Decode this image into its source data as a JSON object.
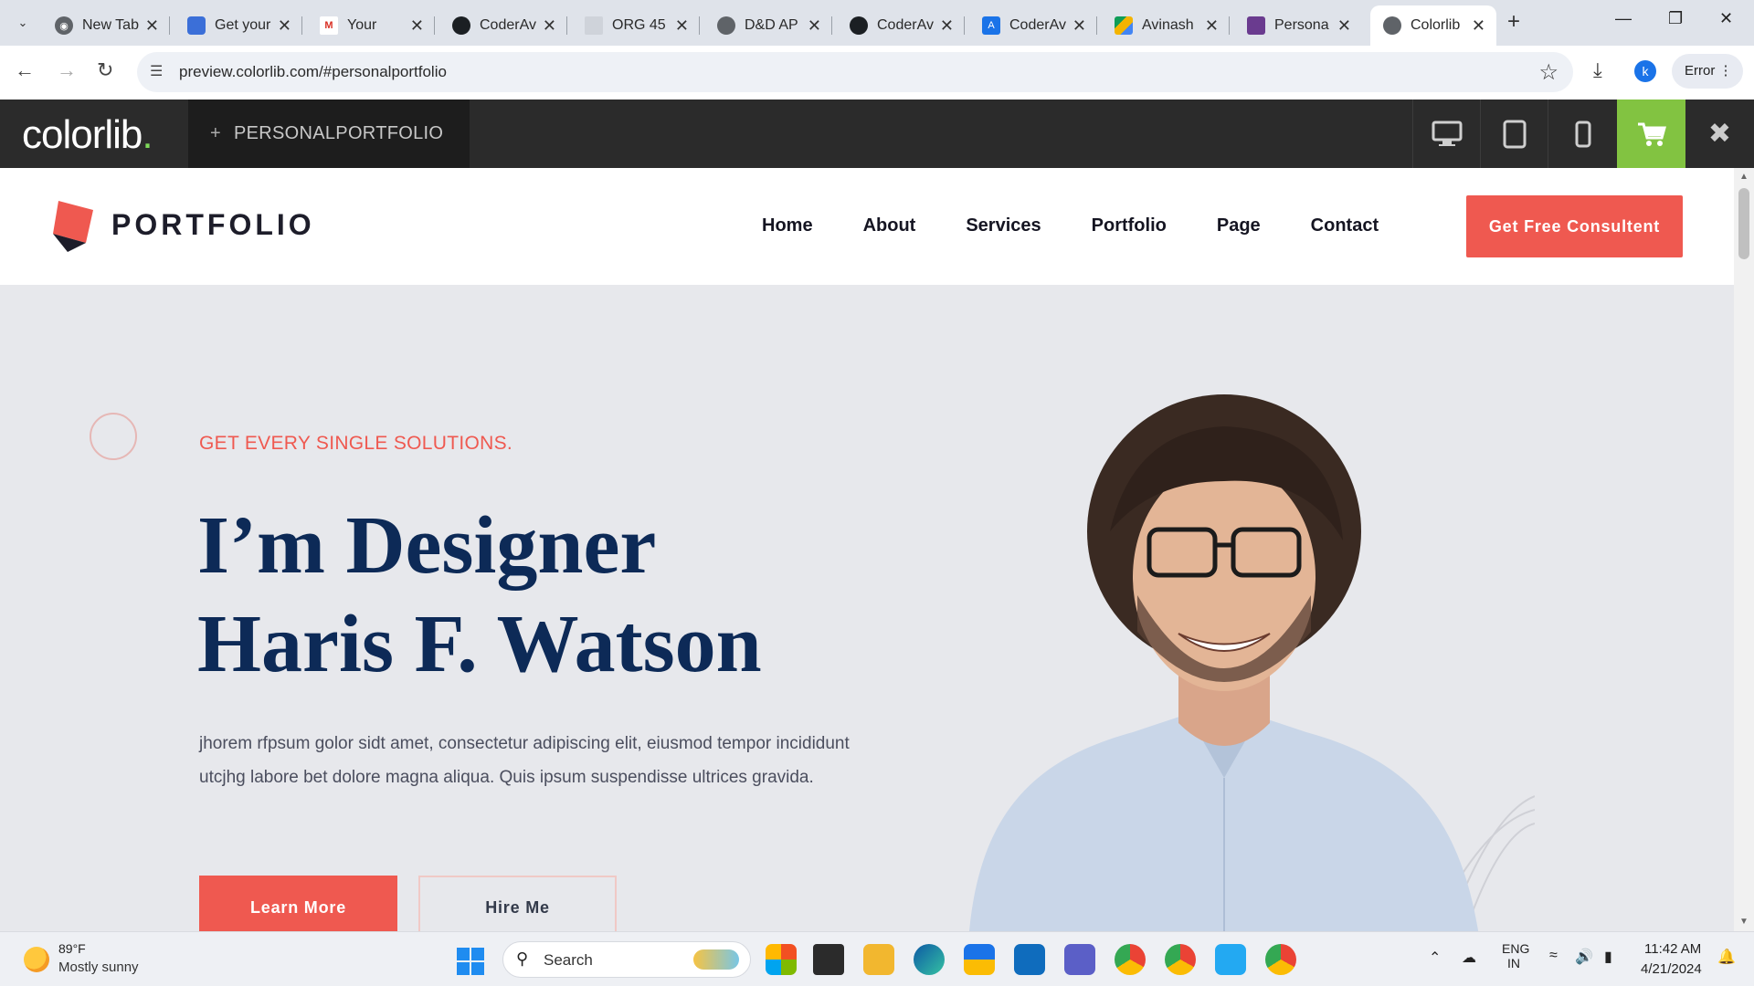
{
  "browser": {
    "tabs": [
      {
        "title": "New Tab",
        "icon": "chrome-icon"
      },
      {
        "title": "Get your",
        "icon": "bookmark-icon"
      },
      {
        "title": "Your",
        "icon": "gmail-icon"
      },
      {
        "title": "CoderAv",
        "icon": "github-icon"
      },
      {
        "title": "ORG 45",
        "icon": "page-icon"
      },
      {
        "title": "D&D AP",
        "icon": "globe-icon"
      },
      {
        "title": "CoderAv",
        "icon": "github-icon"
      },
      {
        "title": "CoderAv",
        "icon": "app-icon"
      },
      {
        "title": "Avinash",
        "icon": "drive-icon"
      },
      {
        "title": "Persona",
        "icon": "colorlib-icon"
      },
      {
        "title": "Colorlib",
        "icon": "globe-icon"
      }
    ],
    "url": "preview.colorlib.com/#personalportfolio",
    "profile_initial": "k",
    "error_chip": "Error"
  },
  "colorlib_bar": {
    "logo": "colorlib",
    "logo_dot": ".",
    "plus": "+",
    "theme_name": "PERSONALPORTFOLIO",
    "accent": "#82c341"
  },
  "site": {
    "brand": "PORTFOLIO",
    "nav": [
      "Home",
      "About",
      "Services",
      "Portfolio",
      "Page",
      "Contact"
    ],
    "cta": "Get Free Consultent",
    "accent": "#ef5950",
    "heading_color": "#0d2a57"
  },
  "hero": {
    "eyebrow": "GET EVERY SINGLE SOLUTIONS.",
    "title_line1": "I’m Designer",
    "title_line2": "Haris F. Watson",
    "lead": "jhorem rfpsum golor sidt amet, consectetur adipiscing elit, eiusmod tempor incididunt utcjhg labore bet dolore magna aliqua. Quis ipsum suspendisse ultrices gravida.",
    "btn_primary": "Learn More",
    "btn_secondary": "Hire Me"
  },
  "taskbar": {
    "weather_temp": "89°F",
    "weather_desc": "Mostly sunny",
    "search": "Search",
    "lang_line1": "ENG",
    "lang_line2": "IN",
    "time": "11:42 AM",
    "date": "4/21/2024"
  }
}
